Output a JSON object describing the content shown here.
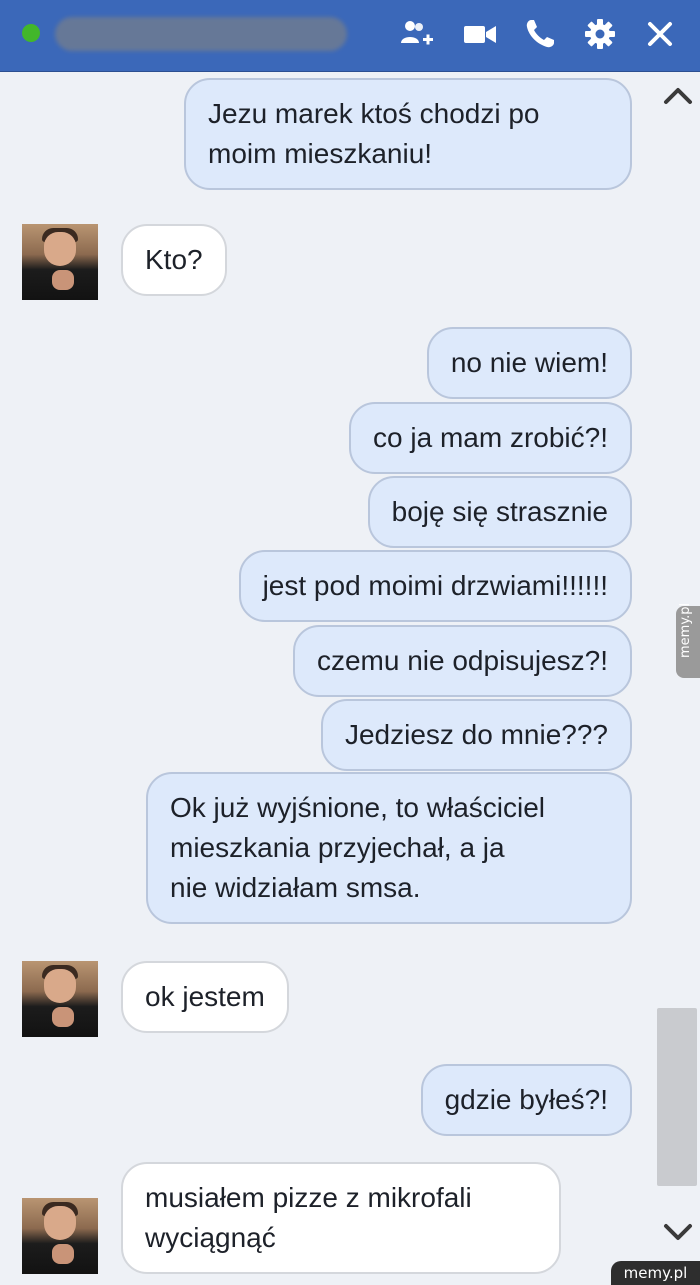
{
  "header": {
    "icons": [
      "add-people-icon",
      "video-call-icon",
      "phone-call-icon",
      "settings-gear-icon",
      "close-icon"
    ],
    "accent_color": "#3b68b9",
    "status_color": "#42b72a"
  },
  "messages": [
    {
      "from": "me",
      "lines": [
        "Jezu marek ktoś chodzi po",
        "moim mieszkaniu!"
      ]
    },
    {
      "from": "friend",
      "lines": [
        "Kto?"
      ]
    },
    {
      "from": "me",
      "lines": [
        "no nie wiem!"
      ]
    },
    {
      "from": "me",
      "lines": [
        "co ja mam zrobić?!"
      ]
    },
    {
      "from": "me",
      "lines": [
        "boję się strasznie"
      ]
    },
    {
      "from": "me",
      "lines": [
        "jest pod moimi drzwiami!!!!!!"
      ]
    },
    {
      "from": "me",
      "lines": [
        "czemu nie odpisujesz?!"
      ]
    },
    {
      "from": "me",
      "lines": [
        "Jedziesz do mnie???"
      ]
    },
    {
      "from": "me",
      "lines": [
        "Ok już wyjśnione, to właściciel",
        "mieszkania przyjechał, a ja",
        "nie widziałam smsa."
      ]
    },
    {
      "from": "friend",
      "lines": [
        "ok jestem"
      ]
    },
    {
      "from": "me",
      "lines": [
        "gdzie byłeś?!"
      ]
    },
    {
      "from": "friend",
      "lines": [
        "musiałem pizze z mikrofali",
        "wyciągnąć"
      ]
    }
  ],
  "watermark": {
    "side": "memy.pl",
    "bottom": "memy.pl"
  }
}
